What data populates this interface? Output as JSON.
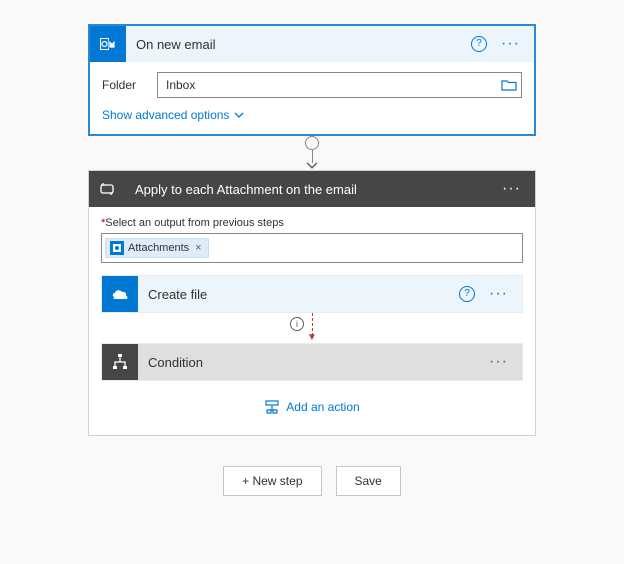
{
  "trigger": {
    "title": "On new email",
    "folder_label": "Folder",
    "folder_value": "Inbox",
    "advanced_link": "Show advanced options"
  },
  "foreach": {
    "title": "Apply to each Attachment on the email",
    "select_label_required": "*",
    "select_label": "Select an output from previous steps",
    "token": "Attachments",
    "token_remove": "×"
  },
  "create_file": {
    "title": "Create file"
  },
  "condition": {
    "title": "Condition"
  },
  "actions": {
    "add_action": "Add an action",
    "new_step": "+ New step",
    "save": "Save"
  },
  "icons": {
    "help": "?",
    "info": "i",
    "more": "···"
  }
}
